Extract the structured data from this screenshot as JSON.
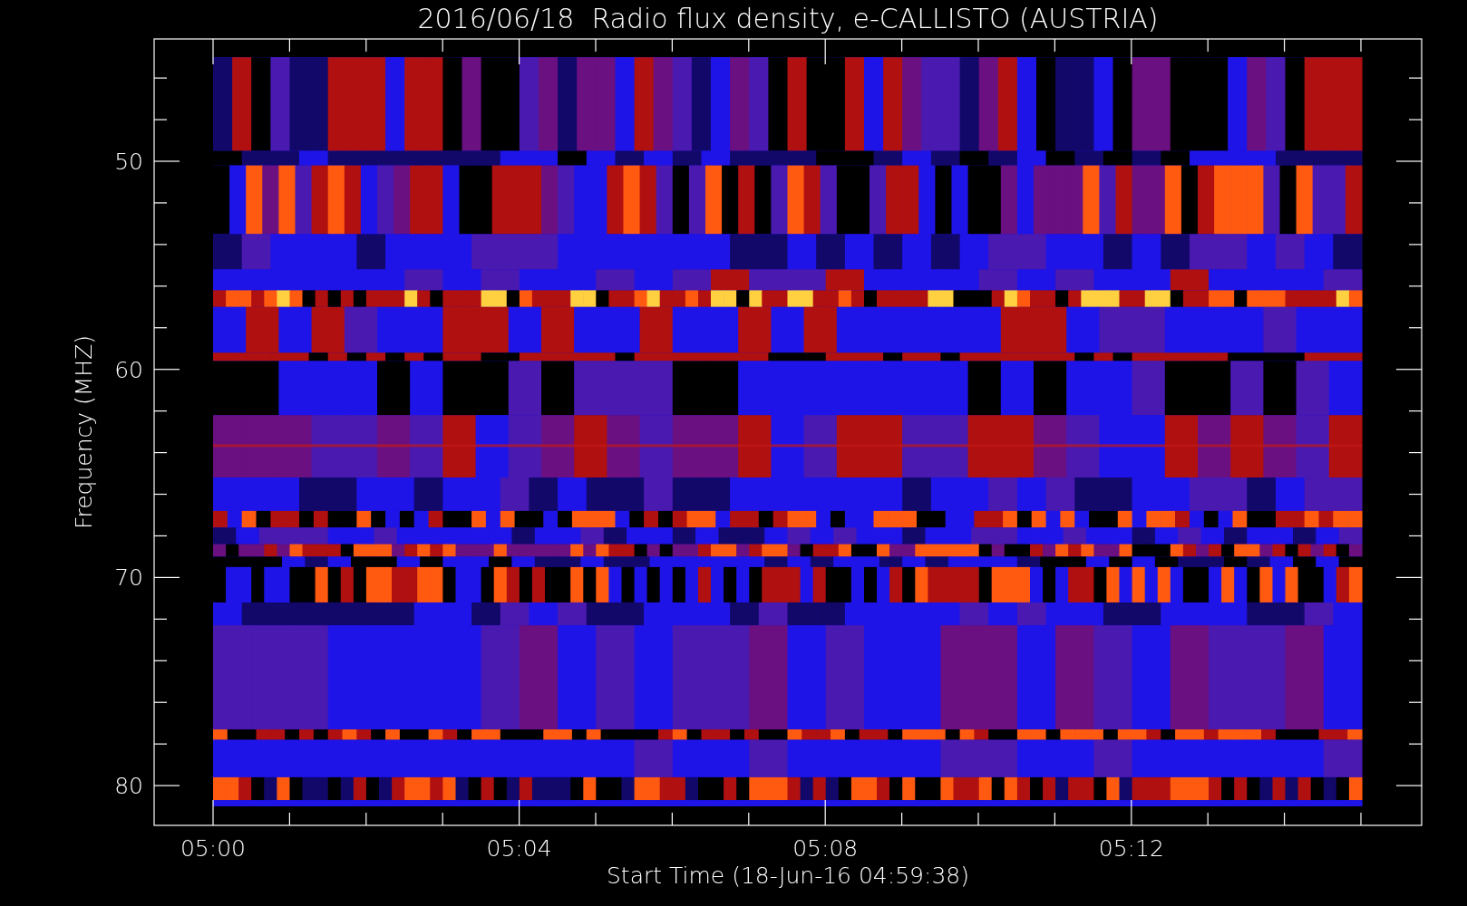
{
  "plot": {
    "title": "2016/06/18  Radio flux density, e-CALLISTO (AUSTRIA)",
    "ylabel": "Frequency (MHZ)",
    "xlabel": "Start Time (18-Jun-16 04:59:38)",
    "yticks": [
      "50",
      "60",
      "70",
      "80"
    ],
    "xticks": [
      "05:00",
      "05:04",
      "05:08",
      "05:12"
    ]
  }
}
